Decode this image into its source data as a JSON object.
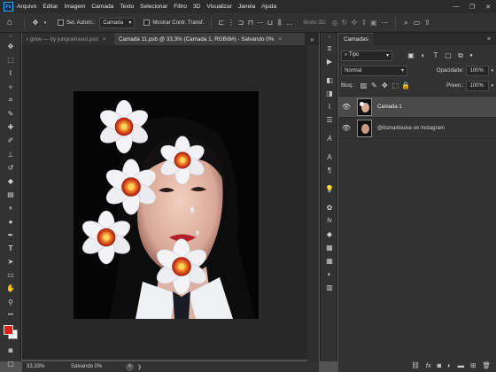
{
  "app": {
    "logo_text": "Ps"
  },
  "menu": [
    "Arquivo",
    "Editar",
    "Imagem",
    "Camada",
    "Texto",
    "Selecionar",
    "Filtro",
    "3D",
    "Visualizar",
    "Janela",
    "Ajuda"
  ],
  "window_controls": {
    "minimize": "—",
    "maximize": "❐",
    "close": "✕"
  },
  "options_bar": {
    "auto_select_label": "Sel. Autom.:",
    "auto_select_target": "Camada",
    "show_transform_label": "Mostrar Contr. Transf.",
    "mode3d_label": "Modo 3D:"
  },
  "tabs": [
    {
      "label": "r glow — by jungrainsoul.psd",
      "active": false
    },
    {
      "label": "Camada 11.psb @ 33,3% (Camada 1, RGB/8#) - Salvando 0%",
      "active": true
    }
  ],
  "tabs_overflow": "»",
  "status": {
    "zoom": "33,33%",
    "progress": "Salvando 0%"
  },
  "layers_panel": {
    "title": "Camadas",
    "filter_kind": "Tipo",
    "blend_mode": "Normal",
    "opacity_label": "Opacidade:",
    "opacity_value": "100%",
    "lock_label": "Bloq.:",
    "fill_label": "Preen.:",
    "fill_value": "100%",
    "layers": [
      {
        "name": "Camada 1",
        "selected": true,
        "visible": true
      },
      {
        "name": "@itsmaxlouise on Instagram",
        "selected": false,
        "visible": true
      }
    ]
  },
  "colors": {
    "foreground": "#e21b1b",
    "background": "#ffffff",
    "accent": "#31a8ff"
  }
}
